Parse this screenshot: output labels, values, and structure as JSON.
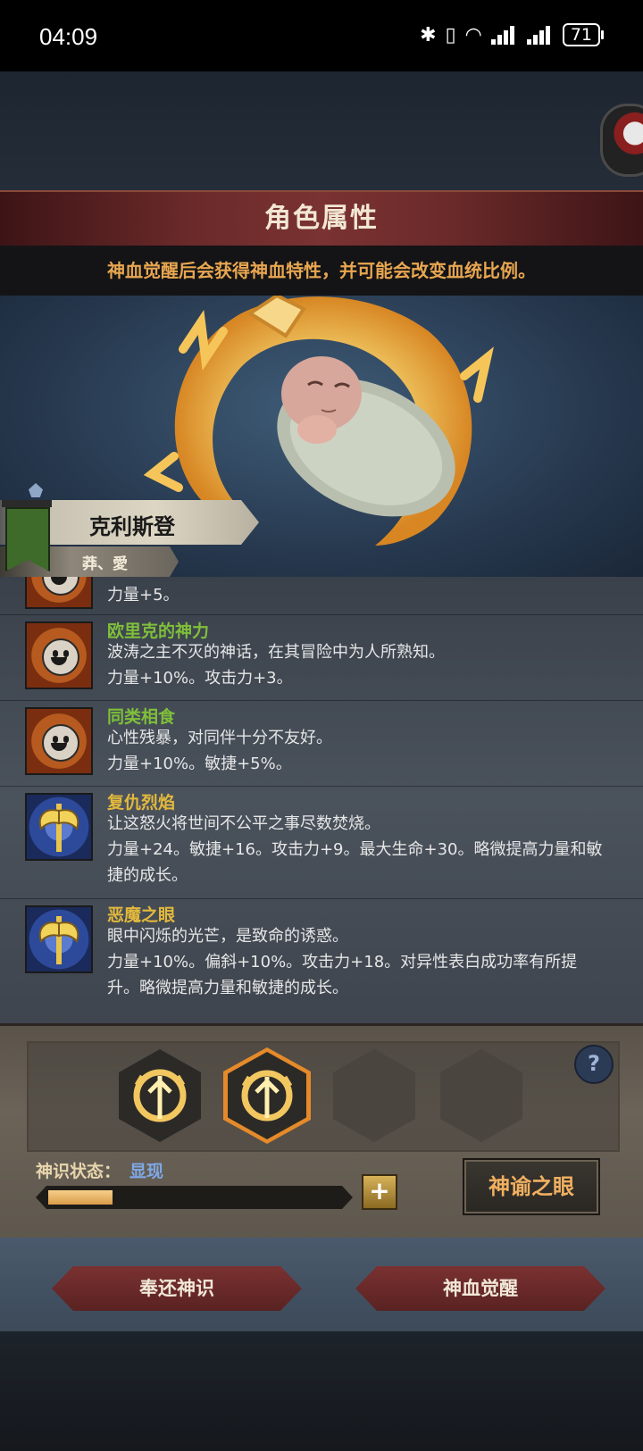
{
  "status_bar": {
    "time": "04:09",
    "battery": "71"
  },
  "header": {
    "title": "角色属性",
    "hint": "神血觉醒后会获得神血特性，并可能会改变血统比例。"
  },
  "character": {
    "name": "克利斯登",
    "subtitle": "莽、愛"
  },
  "traits": [
    {
      "name": "",
      "color": "green",
      "desc1": "",
      "desc2": "力量+5。",
      "icon": "sun-face-icon"
    },
    {
      "name": "欧里克的神力",
      "color": "green",
      "desc1": "波涛之主不灭的神话，在其冒险中为人所熟知。",
      "desc2": "力量+10%。攻击力+3。",
      "icon": "sun-face-icon"
    },
    {
      "name": "同类相食",
      "color": "green",
      "desc1": "心性残暴，对同伴十分不友好。",
      "desc2": "力量+10%。敏捷+5%。",
      "icon": "sun-face-icon"
    },
    {
      "name": "复仇烈焰",
      "color": "yellow",
      "desc1": "让这怒火将世间不公平之事尽数焚烧。",
      "desc2": "力量+24。敏捷+16。攻击力+9。最大生命+30。略微提高力量和敏捷的成长。",
      "icon": "axe-icon"
    },
    {
      "name": "恶魔之眼",
      "color": "yellow",
      "desc1": "眼中闪烁的光芒，是致命的诱惑。",
      "desc2": "力量+10%。偏斜+10%。攻击力+18。对异性表白成功率有所提升。略微提高力量和敏捷的成长。",
      "icon": "axe-icon"
    }
  ],
  "panel": {
    "state_label": "神识状态：",
    "state_value": "显现",
    "progress": 0.22,
    "help": "?",
    "plus": "+",
    "oracle_button": "神谕之眼"
  },
  "buttons": {
    "return": "奉还神识",
    "awaken": "神血觉醒"
  },
  "colors": {
    "accent": "#e8a650",
    "green": "#7fbf3a",
    "yellow": "#e3b93c",
    "blue": "#7ea8e6"
  }
}
